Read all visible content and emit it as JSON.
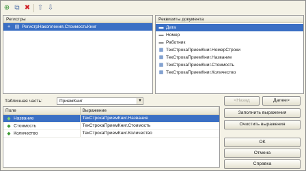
{
  "toolbar": {
    "items": [
      {
        "name": "add-icon",
        "glyph": "⊕",
        "color": "#2f8f2f"
      },
      {
        "name": "copy-icon",
        "glyph": "⧉",
        "color": "#4a6fa8"
      },
      {
        "name": "delete-icon",
        "glyph": "✖",
        "color": "#d2232a"
      },
      {
        "name": "move-up-icon",
        "glyph": "⇧",
        "color": "#6b7fa6"
      },
      {
        "name": "move-down-icon",
        "glyph": "⇩",
        "color": "#6b7fa6"
      }
    ]
  },
  "registers": {
    "header": "Регистры",
    "items": [
      {
        "label": "РегистрНакопления.СтоимостьКниг",
        "icon": "register-icon",
        "selected": true
      }
    ]
  },
  "requisites": {
    "header": "Реквизиты документа",
    "items": [
      {
        "label": "Дата",
        "icon": "field-icon",
        "selected": true
      },
      {
        "label": "Номер",
        "icon": "field-icon",
        "selected": false
      },
      {
        "label": "Работник",
        "icon": "field-icon",
        "selected": false
      },
      {
        "label": "ТекСтрокаПриемКниг.НомерСтроки",
        "icon": "table-field-icon",
        "selected": false
      },
      {
        "label": "ТекСтрокаПриемКниг.Название",
        "icon": "table-field-icon",
        "selected": false
      },
      {
        "label": "ТекСтрокаПриемКниг.Стоимость",
        "icon": "table-field-icon",
        "selected": false
      },
      {
        "label": "ТекСтрокаПриемКниг.Количество",
        "icon": "table-field-icon",
        "selected": false
      }
    ]
  },
  "tabular": {
    "label": "Табличная часть:",
    "value": "ПриемКниг"
  },
  "mapping": {
    "columns": [
      "Поле",
      "Выражение"
    ],
    "rows": [
      {
        "field": "Название",
        "expression": "ТекСтрокаПриемКниг.Название",
        "selected": true
      },
      {
        "field": "Стоимость",
        "expression": "ТекСтрокаПриемКниг.Стоимость",
        "selected": false
      },
      {
        "field": "Количество",
        "expression": "ТекСтрокаПриемКниг.Количество",
        "selected": false
      }
    ]
  },
  "buttons": {
    "back": "<Назад",
    "next": "Далее>",
    "fill": "Заполнить выражения",
    "clear": "Очистить выражения",
    "ok": "ОК",
    "cancel": "Отмена",
    "help": "Справка"
  },
  "colors": {
    "selection": "#3a6fc4",
    "window_bg": "#f4f2e6"
  }
}
